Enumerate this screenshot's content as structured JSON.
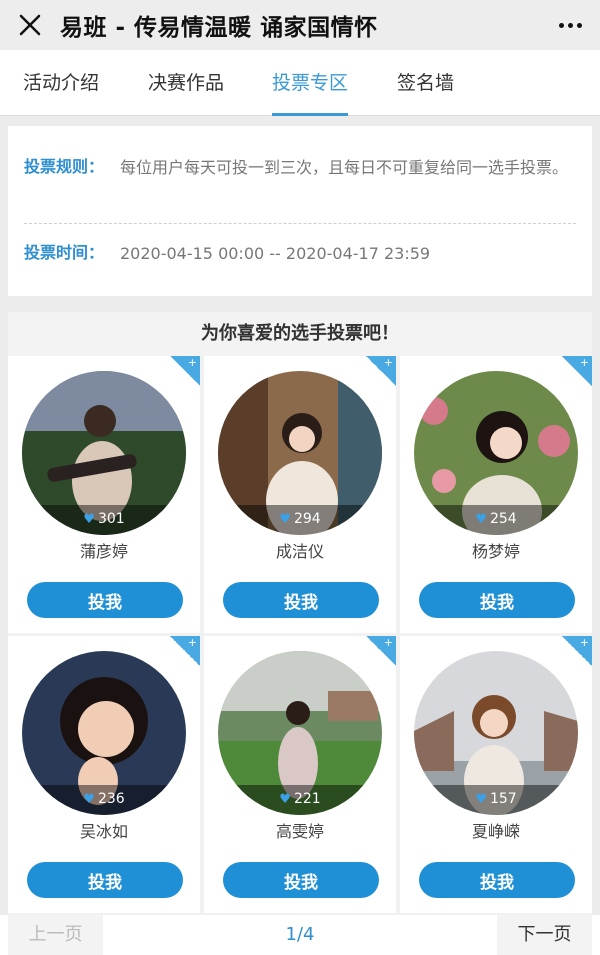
{
  "header": {
    "title": "易班 - 传易情温暖 诵家国情怀",
    "close_icon": "close-icon",
    "more_icon": "more-dots-icon"
  },
  "tabs": [
    {
      "label": "活动介绍",
      "active": false
    },
    {
      "label": "决赛作品",
      "active": false
    },
    {
      "label": "投票专区",
      "active": true
    },
    {
      "label": "签名墙",
      "active": false
    }
  ],
  "rules": {
    "rule_label": "投票规则：",
    "rule_text": "每位用户每天可投一到三次，且每日不可重复给同一选手投票。",
    "time_label": "投票时间：",
    "time_text": "2020-04-15 00:00 -- 2020-04-17 23:59"
  },
  "vote": {
    "header": "为你喜爱的选手投票吧！",
    "button_label": "投我",
    "candidates": [
      {
        "name": "蒲彦婷",
        "likes": "301"
      },
      {
        "name": "成洁仪",
        "likes": "294"
      },
      {
        "name": "杨梦婷",
        "likes": "254"
      },
      {
        "name": "吴冰如",
        "likes": "236"
      },
      {
        "name": "高雯婷",
        "likes": "221"
      },
      {
        "name": "夏峥嵘",
        "likes": "157"
      }
    ]
  },
  "pager": {
    "prev": "上一页",
    "page": "1/4",
    "next": "下一页"
  },
  "colors": {
    "accent": "#3a9ad6",
    "button": "#1f8fd6",
    "corner": "#48a9e3"
  }
}
